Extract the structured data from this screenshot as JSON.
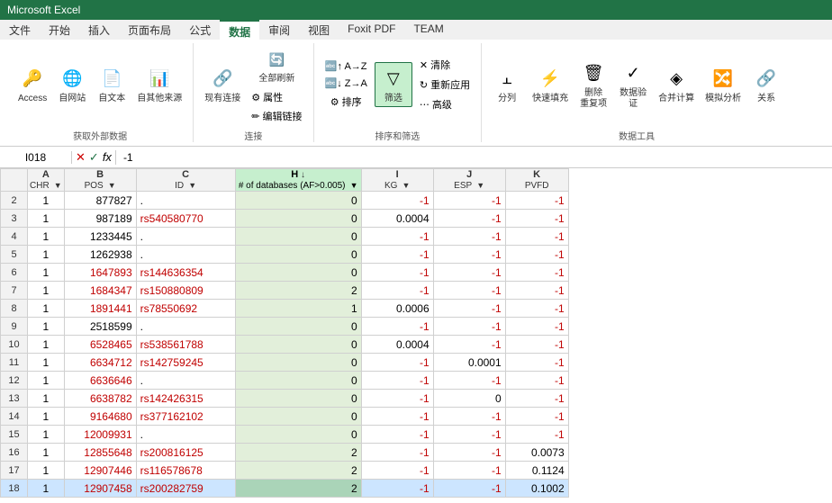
{
  "titleBar": {
    "text": "Microsoft Excel"
  },
  "ribbonTabs": [
    {
      "label": "文件",
      "active": false
    },
    {
      "label": "开始",
      "active": false
    },
    {
      "label": "插入",
      "active": false
    },
    {
      "label": "页面布局",
      "active": false
    },
    {
      "label": "公式",
      "active": false
    },
    {
      "label": "数据",
      "active": true
    },
    {
      "label": "审阅",
      "active": false
    },
    {
      "label": "视图",
      "active": false
    },
    {
      "label": "Foxit PDF",
      "active": false
    },
    {
      "label": "TEAM",
      "active": false
    }
  ],
  "ribbonGroups": [
    {
      "name": "获取外部数据",
      "buttons": [
        {
          "id": "access-btn",
          "icon": "🔑",
          "label": "Access"
        },
        {
          "id": "web-btn",
          "icon": "🌐",
          "label": "自网站"
        },
        {
          "id": "text-btn",
          "icon": "📄",
          "label": "自文本"
        },
        {
          "id": "other-btn",
          "icon": "📊",
          "label": "自其他来源"
        }
      ]
    },
    {
      "name": "连接",
      "buttons": [
        {
          "id": "existing-conn-btn",
          "icon": "🔗",
          "label": "现有连接"
        },
        {
          "id": "refresh-all-btn",
          "icon": "🔄",
          "label": "全部刷新"
        },
        {
          "id": "props-btn",
          "icon": "⚙",
          "label": "属性"
        },
        {
          "id": "edit-links-btn",
          "icon": "✏",
          "label": "编辑链接"
        }
      ]
    },
    {
      "name": "排序和筛选",
      "buttons": [
        {
          "id": "sort-az-btn",
          "icon": "↑",
          "label": "排序"
        },
        {
          "id": "filter-btn",
          "icon": "▽",
          "label": "筛选"
        },
        {
          "id": "clear-btn",
          "icon": "✕",
          "label": "清除"
        },
        {
          "id": "reapply-btn",
          "icon": "↻",
          "label": "重新应用"
        },
        {
          "id": "advanced-btn",
          "icon": "⋯",
          "label": "高级"
        }
      ]
    },
    {
      "name": "数据工具",
      "buttons": [
        {
          "id": "split-btn",
          "icon": "|||",
          "label": "分列"
        },
        {
          "id": "fill-btn",
          "icon": "⚡",
          "label": "快速填充"
        },
        {
          "id": "remove-dup-btn",
          "icon": "🗑",
          "label": "删除\n重复项"
        },
        {
          "id": "validate-btn",
          "icon": "✓",
          "label": "数据验\n证"
        },
        {
          "id": "consolidate-btn",
          "icon": "◈",
          "label": "合并计算"
        },
        {
          "id": "whatif-btn",
          "icon": "🔀",
          "label": "模拟分析"
        },
        {
          "id": "related-btn",
          "icon": "🔗",
          "label": "关系"
        }
      ]
    }
  ],
  "nameBox": "I018",
  "formulaValue": "-1",
  "columns": [
    {
      "label": "A",
      "subLabel": "CHR",
      "width": 40,
      "hasFilter": true
    },
    {
      "label": "B",
      "subLabel": "POS",
      "width": 80,
      "hasFilter": true
    },
    {
      "label": "C",
      "subLabel": "ID",
      "width": 110,
      "hasFilter": true
    },
    {
      "label": "H",
      "subLabel": "# of databases (AF>0.005)",
      "width": 140,
      "hasFilter": true,
      "highlighted": true,
      "sortArrow": true
    },
    {
      "label": "I",
      "subLabel": "KG",
      "width": 80,
      "hasFilter": true
    },
    {
      "label": "J",
      "subLabel": "ESP",
      "width": 80,
      "hasFilter": true
    },
    {
      "label": "K",
      "subLabel": "PVFD",
      "width": 70,
      "hasFilter": false
    }
  ],
  "rows": [
    {
      "rowNum": "2",
      "a": "1",
      "b": "877827",
      "c": ".",
      "h": "0",
      "i": "-1",
      "j": "-1",
      "k": "-1",
      "selected": false
    },
    {
      "rowNum": "3",
      "a": "1",
      "b": "987189",
      "c": "rs540580770",
      "h": "0",
      "i": "0.0004",
      "j": "-1",
      "k": "-1",
      "selected": false
    },
    {
      "rowNum": "4",
      "a": "1",
      "b": "1233445",
      "c": ".",
      "h": "0",
      "i": "-1",
      "j": "-1",
      "k": "-1",
      "selected": false
    },
    {
      "rowNum": "5",
      "a": "1",
      "b": "1262938",
      "c": ".",
      "h": "0",
      "i": "-1",
      "j": "-1",
      "k": "-1",
      "selected": false
    },
    {
      "rowNum": "6",
      "a": "1",
      "b": "1647893",
      "c": "rs144636354",
      "h": "0",
      "i": "-1",
      "j": "-1",
      "k": "-1",
      "selected": false
    },
    {
      "rowNum": "7",
      "a": "1",
      "b": "1684347",
      "c": "rs150880809",
      "h": "2",
      "i": "-1",
      "j": "-1",
      "k": "-1",
      "selected": false
    },
    {
      "rowNum": "8",
      "a": "1",
      "b": "1891441",
      "c": "rs78550692",
      "h": "1",
      "i": "0.0006",
      "j": "-1",
      "k": "-1",
      "selected": false
    },
    {
      "rowNum": "9",
      "a": "1",
      "b": "2518599",
      "c": ".",
      "h": "0",
      "i": "-1",
      "j": "-1",
      "k": "-1",
      "selected": false
    },
    {
      "rowNum": "10",
      "a": "1",
      "b": "6528465",
      "c": "rs538561788",
      "h": "0",
      "i": "0.0004",
      "j": "-1",
      "k": "-1",
      "selected": false
    },
    {
      "rowNum": "11",
      "a": "1",
      "b": "6634712",
      "c": "rs142759245",
      "h": "0",
      "i": "-1",
      "j": "0.0001",
      "k": "-1",
      "selected": false
    },
    {
      "rowNum": "12",
      "a": "1",
      "b": "6636646",
      "c": ".",
      "h": "0",
      "i": "-1",
      "j": "-1",
      "k": "-1",
      "selected": false
    },
    {
      "rowNum": "13",
      "a": "1",
      "b": "6638782",
      "c": "rs142426315",
      "h": "0",
      "i": "-1",
      "j": "0",
      "k": "-1",
      "selected": false
    },
    {
      "rowNum": "14",
      "a": "1",
      "b": "9164680",
      "c": "rs377162102",
      "h": "0",
      "i": "-1",
      "j": "-1",
      "k": "-1",
      "selected": false
    },
    {
      "rowNum": "15",
      "a": "1",
      "b": "12009931",
      "c": ".",
      "h": "0",
      "i": "-1",
      "j": "-1",
      "k": "-1",
      "selected": false
    },
    {
      "rowNum": "16",
      "a": "1",
      "b": "12855648",
      "c": "rs200816125",
      "h": "2",
      "i": "-1",
      "j": "-1",
      "k": "0.0073",
      "selected": false
    },
    {
      "rowNum": "17",
      "a": "1",
      "b": "12907446",
      "c": "rs116578678",
      "h": "2",
      "i": "-1",
      "j": "-1",
      "k": "0.1124",
      "selected": false
    },
    {
      "rowNum": "18",
      "a": "1",
      "b": "12907458",
      "c": "rs200282759",
      "h": "2",
      "i": "-1",
      "j": "-1",
      "k": "0.1002",
      "selected": true
    }
  ],
  "redIds": [
    "rs540580770",
    "rs144636354",
    "rs150880809",
    "rs78550692",
    "rs538561788",
    "rs142759245",
    "rs142426315",
    "rs377162102",
    "rs200816125",
    "rs116578678",
    "rs200282759"
  ],
  "redPOS": [
    "1647893",
    "1684347",
    "1891441",
    "6528465",
    "6634712",
    "6636646",
    "6638782",
    "9164680",
    "12009931",
    "12855648",
    "12907446",
    "12907458"
  ]
}
